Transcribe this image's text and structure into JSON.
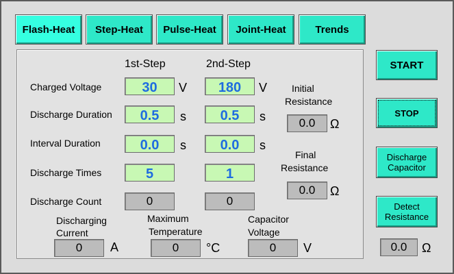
{
  "tabs": [
    {
      "label": "Flash-Heat"
    },
    {
      "label": "Step-Heat"
    },
    {
      "label": "Pulse-Heat"
    },
    {
      "label": "Joint-Heat"
    },
    {
      "label": "Trends"
    }
  ],
  "columns": {
    "first": "1st-Step",
    "second": "2nd-Step"
  },
  "rows": {
    "charged_voltage": {
      "label": "Charged Voltage",
      "step1": "30",
      "step2": "180",
      "unit": "V"
    },
    "discharge_duration": {
      "label": "Discharge Duration",
      "step1": "0.5",
      "step2": "0.5",
      "unit": "s"
    },
    "interval_duration": {
      "label": "Interval Duration",
      "step1": "0.0",
      "step2": "0.0",
      "unit": "s"
    },
    "discharge_times": {
      "label": "Discharge Times",
      "step1": "5",
      "step2": "1"
    },
    "discharge_count": {
      "label": "Discharge Count",
      "step1": "0",
      "step2": "0"
    }
  },
  "initial_resistance": {
    "label_line1": "Initial",
    "label_line2": "Resistance",
    "value": "0.0",
    "unit": "Ω"
  },
  "final_resistance": {
    "label_line1": "Final",
    "label_line2": "Resistance",
    "value": "0.0",
    "unit": "Ω"
  },
  "discharging_current": {
    "label_line1": "Discharging",
    "label_line2": "Current",
    "value": "0",
    "unit": "A"
  },
  "max_temperature": {
    "label_line1": "Maximum",
    "label_line2": "Temperature",
    "value": "0",
    "unit": "°C"
  },
  "capacitor_voltage": {
    "label_line1": "Capacitor",
    "label_line2": "Voltage",
    "value": "0",
    "unit": "V"
  },
  "side_buttons": {
    "start": "START",
    "stop": "STOP",
    "discharge_line1": "Discharge",
    "discharge_line2": "Capacitor",
    "detect_line1": "Detect",
    "detect_line2": "Resistance"
  },
  "detect_readout": {
    "value": "0.0",
    "unit": "Ω"
  },
  "colors": {
    "accent": "#2EE8C8",
    "input_bg": "#C8F8B4",
    "input_text": "#1E6CE0",
    "display_bg": "#BCBCBC",
    "window_bg": "#DCDCDC"
  }
}
